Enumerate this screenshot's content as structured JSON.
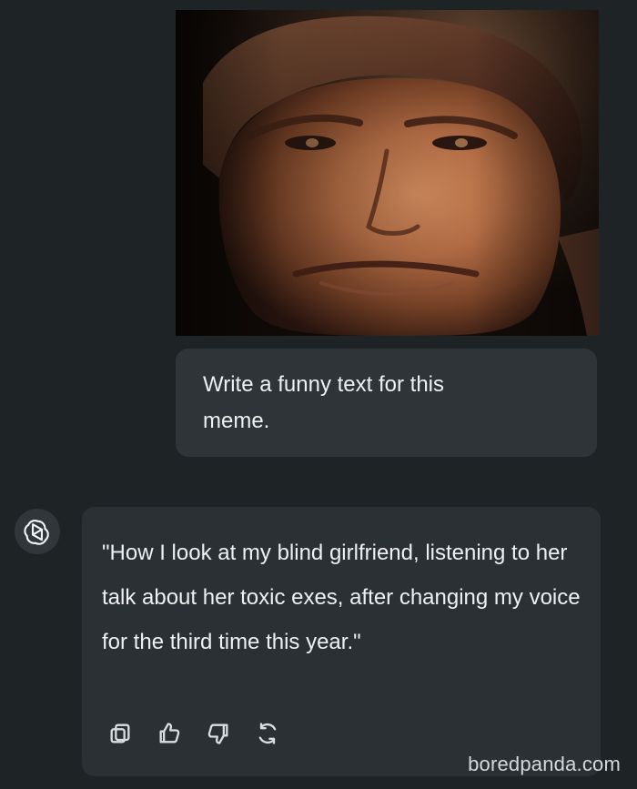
{
  "user_image": {
    "icon": "portrait-image",
    "description_visible": false
  },
  "user_message": {
    "text": "Write a funny text for this meme."
  },
  "assistant": {
    "avatar_icon": "openai-logo-icon",
    "text": "\"How I look at my blind girlfriend, listening to her talk about her toxic exes, after changing my voice for the third time this year.\""
  },
  "actions": [
    {
      "label": "Copy",
      "icon": "copy-icon"
    },
    {
      "label": "Like",
      "icon": "thumbs-up-icon"
    },
    {
      "label": "Dislike",
      "icon": "thumbs-down-icon"
    },
    {
      "label": "Regenerate",
      "icon": "regenerate-icon"
    }
  ],
  "watermark": {
    "text": "boredpanda.com"
  },
  "colors": {
    "background": "#1e2326",
    "user_bubble": "#2e3438",
    "assistant_bubble": "#2b3035",
    "text": "#eef0f1",
    "icon": "#d9dde0"
  }
}
